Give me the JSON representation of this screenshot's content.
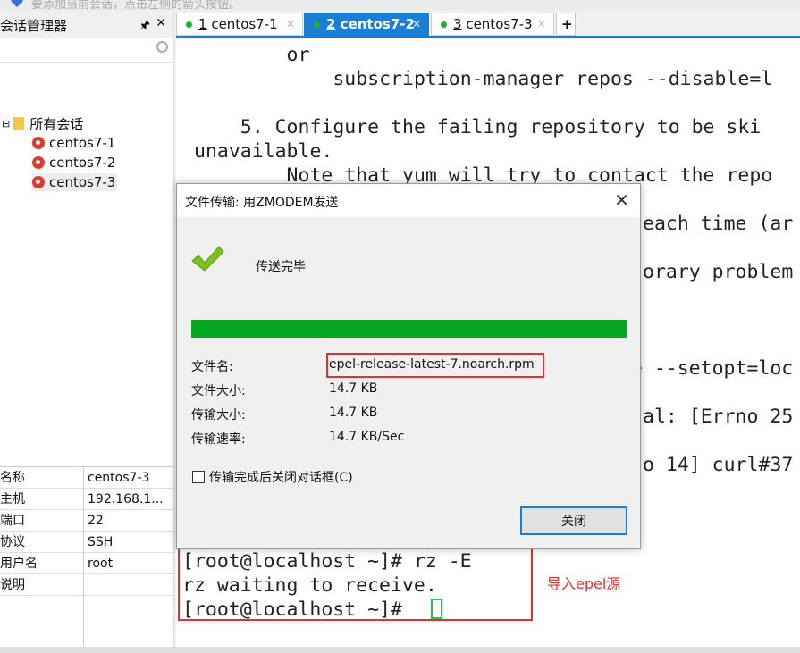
{
  "topbar": {
    "hint": "要添加当前会话，点击左侧的箭头按钮。"
  },
  "session_manager": {
    "title": "会话管理器",
    "root": "所有会话",
    "sessions": [
      "centos7-1",
      "centos7-2",
      "centos7-3"
    ],
    "selected": "centos7-3",
    "properties": [
      {
        "k": "名称",
        "v": "centos7-3"
      },
      {
        "k": "主机",
        "v": "192.168.1..."
      },
      {
        "k": "端口",
        "v": "22"
      },
      {
        "k": "协议",
        "v": "SSH"
      },
      {
        "k": "用户名",
        "v": "root"
      },
      {
        "k": "说明",
        "v": ""
      }
    ]
  },
  "tabs": [
    {
      "num": "1",
      "label": "centos7-1",
      "active": false
    },
    {
      "num": "2",
      "label": "centos7-2",
      "active": true
    },
    {
      "num": "3",
      "label": "centos7-3",
      "active": false
    }
  ],
  "terminal": {
    "lines": [
      "        or",
      "            subscription-manager repos --disable=l",
      "    5. Configure the failing repository to be ski",
      "unavailable.",
      "        Note that yum will try to contact the repo"
    ],
    "fragments": [
      "each time (ar",
      "orary problem",
      "e --setopt=loc",
      "al: [Errno 25",
      "o 14] curl#37"
    ],
    "prompt_lines": [
      "[root@localhost ~]# rz -E",
      "rz waiting to receive.",
      "[root@localhost ~]# "
    ]
  },
  "annotation": "导入epel源",
  "dialog": {
    "title": "文件传输: 用ZMODEM发送",
    "status": "传送完毕",
    "progress_percent": 100,
    "fields": [
      {
        "k": "文件名:",
        "v": "epel-release-latest-7.noarch.rpm"
      },
      {
        "k": "文件大小:",
        "v": "14.7 KB"
      },
      {
        "k": "传输大小:",
        "v": "14.7 KB"
      },
      {
        "k": "传输速率:",
        "v": "14.7 KB/Sec"
      }
    ],
    "checkbox_label": "传输完成后关闭对话框(C)",
    "checkbox_checked": false,
    "close_label": "关闭"
  },
  "colors": {
    "accent": "#1a7fd4",
    "progress": "#06a823",
    "highlight": "#e03030"
  }
}
